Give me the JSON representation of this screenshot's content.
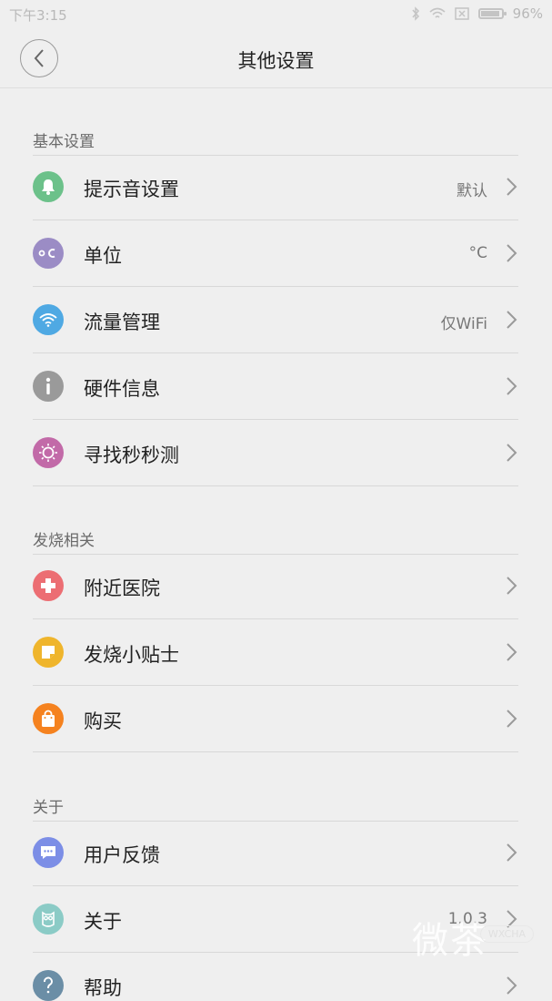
{
  "status": {
    "time": "下午3:15",
    "battery": "96%"
  },
  "header": {
    "title": "其他设置"
  },
  "sections": [
    {
      "title": "基本设置",
      "items": [
        {
          "label": "提示音设置",
          "value": "默认",
          "icon": "bell-icon",
          "color": "#6cc18a"
        },
        {
          "label": "单位",
          "value": "°C",
          "icon": "celsius-icon",
          "color": "#9b8cc5"
        },
        {
          "label": "流量管理",
          "value": "仅WiFi",
          "icon": "wifi-icon",
          "color": "#4fa9e3"
        },
        {
          "label": "硬件信息",
          "value": "",
          "icon": "info-icon",
          "color": "#9a9a9a"
        },
        {
          "label": "寻找秒秒测",
          "value": "",
          "icon": "sun-icon",
          "color": "#c26aa8"
        }
      ]
    },
    {
      "title": "发烧相关",
      "items": [
        {
          "label": "附近医院",
          "value": "",
          "icon": "hospital-cross-icon",
          "color": "#ec6e73"
        },
        {
          "label": "发烧小贴士",
          "value": "",
          "icon": "sticky-note-icon",
          "color": "#efb52c"
        },
        {
          "label": "购买",
          "value": "",
          "icon": "shopping-bag-icon",
          "color": "#f5821f"
        }
      ]
    },
    {
      "title": "关于",
      "items": [
        {
          "label": "用户反馈",
          "value": "",
          "icon": "chat-bubble-icon",
          "color": "#7c8ee6"
        },
        {
          "label": "关于",
          "value": "1.0.3",
          "icon": "owl-icon",
          "color": "#8bcbc6"
        },
        {
          "label": "帮助",
          "value": "",
          "icon": "help-icon",
          "color": "#6b8ea6"
        }
      ]
    }
  ],
  "watermark": {
    "text": "微茶",
    "badge": "WXCHA"
  }
}
